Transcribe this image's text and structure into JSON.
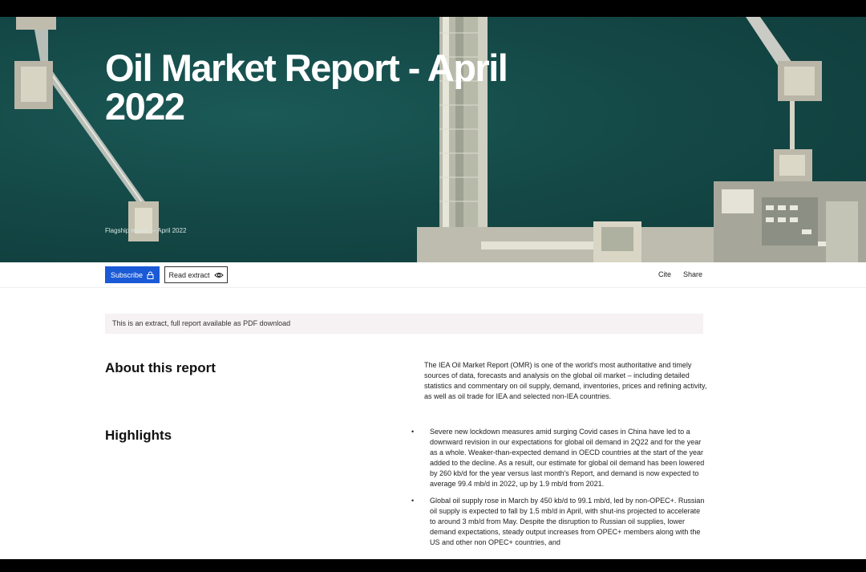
{
  "hero": {
    "title": "Oil Market Report - April 2022",
    "subtitle": "Flagship report — April 2022"
  },
  "toolbar": {
    "subscribe_label": "Subscribe",
    "read_extract_label": "Read extract",
    "cite_label": "Cite",
    "share_label": "Share"
  },
  "notice": {
    "text": "This is an extract, full report available as PDF download"
  },
  "about": {
    "heading": "About this report",
    "text": "The IEA Oil Market Report (OMR) is one of the world's most authoritative and timely sources of data, forecasts and analysis on the global oil market – including detailed statistics and commentary on oil supply, demand, inventories, prices and refining activity, as well as oil trade for IEA and selected non-IEA countries."
  },
  "highlights": {
    "heading": "Highlights",
    "items": [
      "Severe new lockdown measures amid surging Covid cases in China have led to a downward revision in our expectations for global oil demand in 2Q22 and for the year as a whole. Weaker-than-expected demand in OECD countries at the start of the year added to the decline. As a result, our estimate for global oil demand has been lowered by 260 kb/d for the year versus last month's Report, and demand is now expected to average 99.4 mb/d in 2022, up by 1.9 mb/d from 2021.",
      "Global oil supply rose in March by 450 kb/d to 99.1 mb/d, led by non-OPEC+. Russian oil supply is expected to fall by 1.5 mb/d in April, with shut-ins projected to accelerate to around 3 mb/d from May. Despite the disruption to Russian oil supplies, lower demand expectations, steady output increases from OPEC+ members along with the US and other non OPEC+ countries, and"
    ]
  },
  "colors": {
    "accent": "#1a5ad6",
    "hero_water": "#144947",
    "notice_bg": "#f6f1f3"
  },
  "icons": {
    "subscribe": "lock-icon",
    "read_extract": "eye-icon"
  }
}
